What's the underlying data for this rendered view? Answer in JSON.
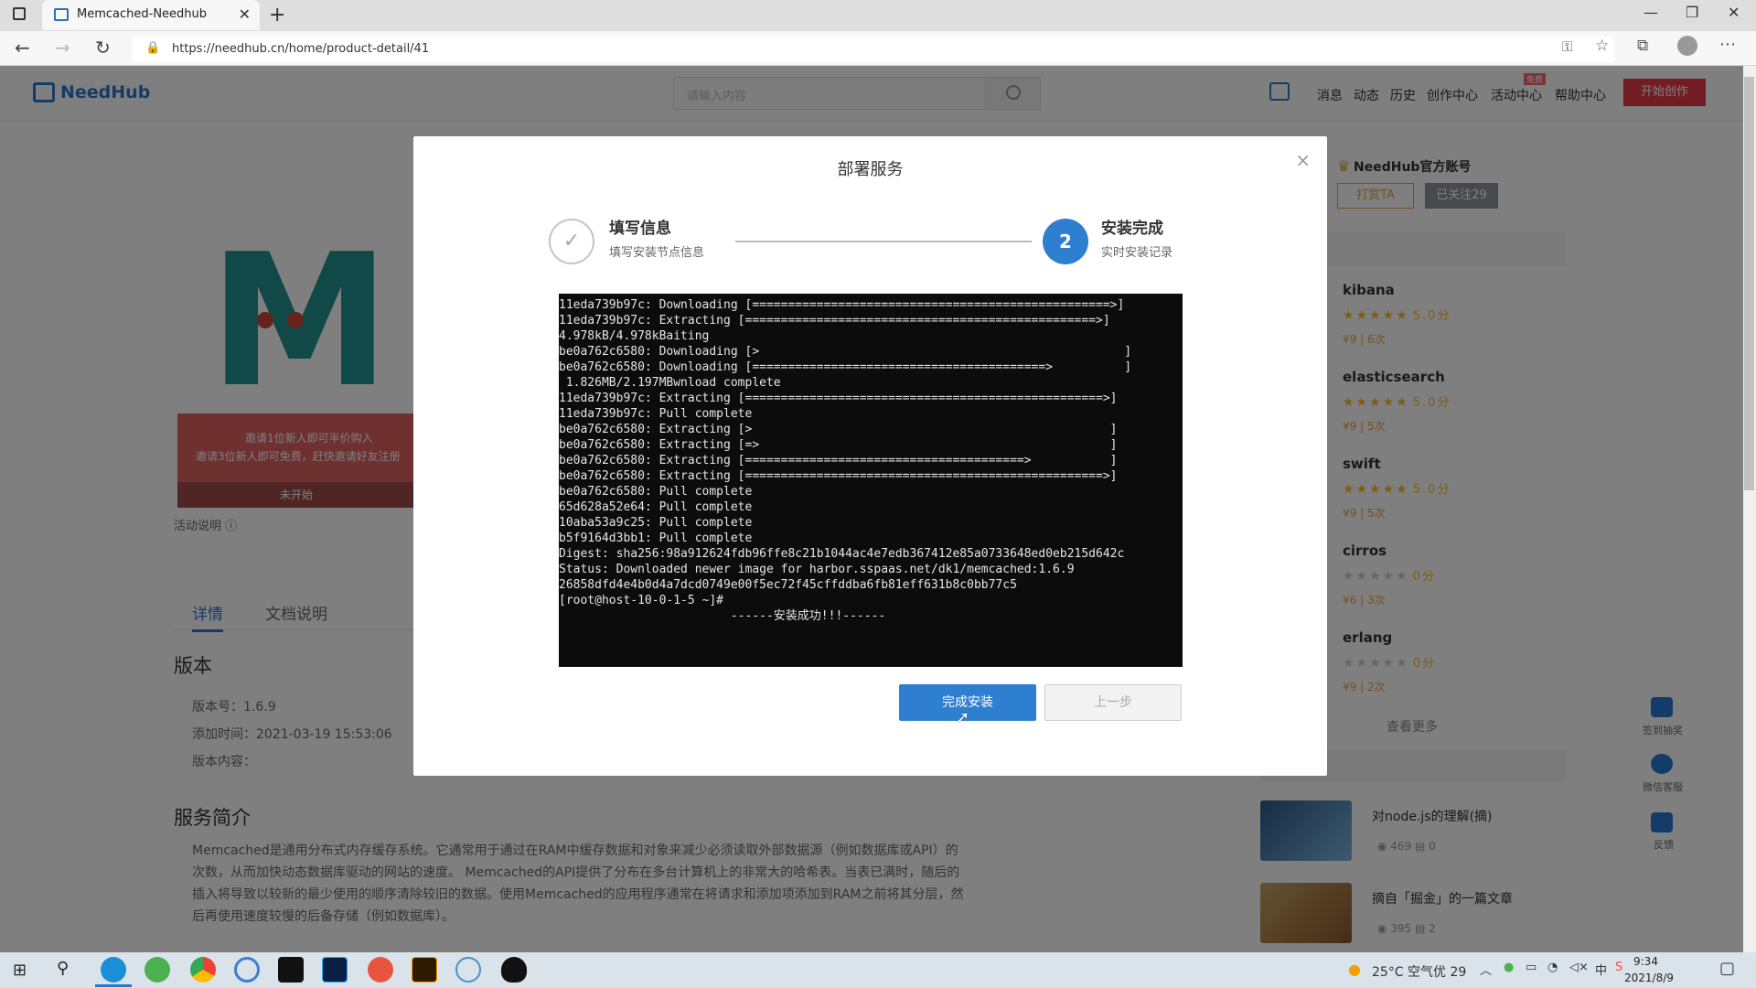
{
  "browser": {
    "tab_title": "Memcached-Needhub",
    "url": "https://needhub.cn/home/product-detail/41",
    "new_tab": "+",
    "tab_close": "✕",
    "win_min": "—",
    "win_restore": "❐",
    "win_close": "✕"
  },
  "header": {
    "logo_text": "NeedHub",
    "search_placeholder": "请输入内容",
    "nav": [
      "消息",
      "动态",
      "历史",
      "创作中心",
      "活动中心",
      "帮助中心"
    ],
    "badge": "免费",
    "start_button": "开始创作"
  },
  "product": {
    "letter": "M",
    "promo_line1": "邀请1位新人即可半价购入",
    "promo_line2": "邀请3位新人即可免费，赶快邀请好友注册",
    "promo_status": "未开始",
    "activity_note": "活动说明 ⓘ",
    "tabs": [
      "详情",
      "文档说明"
    ],
    "version_title": "版本",
    "version_number": "版本号：1.6.9",
    "added_time": "添加时间：2021-03-19 15:53:06",
    "version_content": "版本内容：",
    "service_title": "服务简介",
    "service_desc": "Memcached是通用分布式内存缓存系统。它通常用于通过在RAM中缓存数据和对象来减少必须读取外部数据源（例如数据库或API）的次数，从而加快动态数据库驱动的网站的速度。 Memcached的API提供了分布在多台计算机上的非常大的哈希表。当表已满时，随后的插入将导致以较新的最少使用的顺序清除较旧的数据。使用Memcached的应用程序通常在将请求和添加项添加到RAM之前将其分层，然后再使用速度较慢的后备存储（例如数据库）。"
  },
  "sidebar": {
    "official": "NeedHub官方账号",
    "tip_button": "打赏TA",
    "follow_button": "已关注29",
    "items": [
      {
        "name": "kibana",
        "stars": "★★★★★",
        "score": "5.0分",
        "meta": "¥9 | 6次"
      },
      {
        "name": "elasticsearch",
        "stars": "★★★★★",
        "score": "5.0分",
        "meta": "¥9 | 5次"
      },
      {
        "name": "swift",
        "stars": "★★★★★",
        "score": "5.0分",
        "meta": "¥9 | 5次"
      },
      {
        "name": "cirros",
        "stars": "★★★★★",
        "score": "0分",
        "meta": "¥6 | 3次"
      },
      {
        "name": "erlang",
        "stars": "★★★★★",
        "score": "0分",
        "meta": "¥9 | 2次"
      }
    ],
    "see_more": "查看更多",
    "articles": [
      {
        "title": "对node.js的理解(摘)",
        "views": "469",
        "comments": "0"
      },
      {
        "title": "摘自「掘金」的一篇文章",
        "views": "395",
        "comments": "2"
      }
    ],
    "float": [
      "签到抽奖",
      "微信客服",
      "反馈"
    ]
  },
  "modal": {
    "title": "部署服务",
    "close": "×",
    "step1_icon": "✓",
    "step1_title": "填写信息",
    "step1_sub": "填写安装节点信息",
    "step2_num": "2",
    "step2_title": "安装完成",
    "step2_sub": "实时安装记录",
    "terminal_lines": [
      "11eda739b97c: Downloading [==================================================>]",
      "11eda739b97c: Extracting [=================================================>]",
      "4.978kB/4.978kBaiting",
      "be0a762c6580: Downloading [>                                                   ]",
      "be0a762c6580: Downloading [=========================================>          ]",
      " 1.826MB/2.197MBwnload complete",
      "11eda739b97c: Extracting [==================================================>]",
      "11eda739b97c: Pull complete",
      "be0a762c6580: Extracting [>                                                  ]",
      "be0a762c6580: Extracting [=>                                                 ]",
      "be0a762c6580: Extracting [=======================================>           ]",
      "be0a762c6580: Extracting [==================================================>]",
      "be0a762c6580: Pull complete",
      "65d628a52e64: Pull complete",
      "10aba53a9c25: Pull complete",
      "b5f9164d3bb1: Pull complete",
      "Digest: sha256:98a912624fdb96ffe8c21b1044ac4e7edb367412e85a0733648ed0eb215d642c",
      "Status: Downloaded newer image for harbor.sspaas.net/dk1/memcached:1.6.9",
      "26858dfd4e4b0d4a7dcd0749e00f5ec72f45cffddba6fb81eff631b8c0bb77c5",
      "[root@host-10-0-1-5 ~]#",
      "                        ------安装成功!!!------"
    ],
    "done_button": "完成安装",
    "prev_button": "上一步"
  },
  "taskbar": {
    "weather": "25°C 空气优 29",
    "time": "9:34",
    "date": "2021/8/9"
  },
  "colors": {
    "primary": "#2f7fd0",
    "brand": "#2878d0",
    "danger": "#e63946",
    "star": "#f7ba2a"
  }
}
